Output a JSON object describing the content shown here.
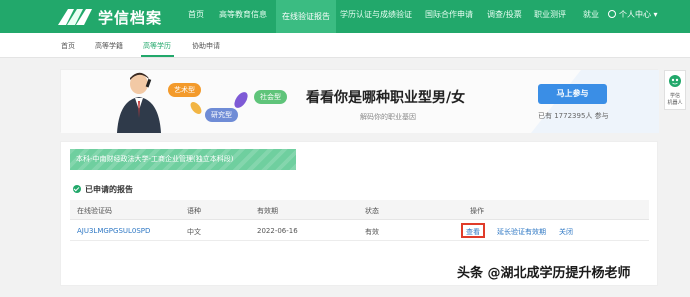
{
  "header": {
    "brand": "学信档案",
    "nav": [
      "首页",
      "高等教育信息",
      "在线验证报告",
      "学历认证与成绩验证",
      "国际合作申请",
      "调查/投票",
      "职业测评",
      "就业"
    ],
    "user": "个人中心 ▾",
    "colors": {
      "primary": "#22a86b",
      "active": "#3bbc82"
    }
  },
  "subnav": {
    "items": [
      "首页",
      "高等学籍",
      "高等学历",
      "协助申请"
    ],
    "active_index": 2
  },
  "banner": {
    "tags": [
      "艺术型",
      "社会型",
      "研究型"
    ],
    "title": "看看你是哪种职业型男/女",
    "subtitle": "解码你的职业基因",
    "button": "马上参与",
    "count": "已有 1772395人 参与"
  },
  "side_widget": {
    "line1": "学信",
    "line2": "机器人"
  },
  "main": {
    "education": "本科-中南财经政法大学-工商企业管理(独立本科段)",
    "section_title": "已申请的报告",
    "table": {
      "headers": [
        "在线验证码",
        "语种",
        "有效期",
        "状态",
        "操作"
      ],
      "rows": [
        {
          "code": "AJU3LMGPGSUL0SPD",
          "lang": "中文",
          "expiry": "2022-06-16",
          "status": "有效",
          "actions": [
            "查看",
            "延长验证有效期",
            "关闭"
          ]
        }
      ]
    }
  },
  "watermark": "头条 @湖北成学历提升杨老师"
}
